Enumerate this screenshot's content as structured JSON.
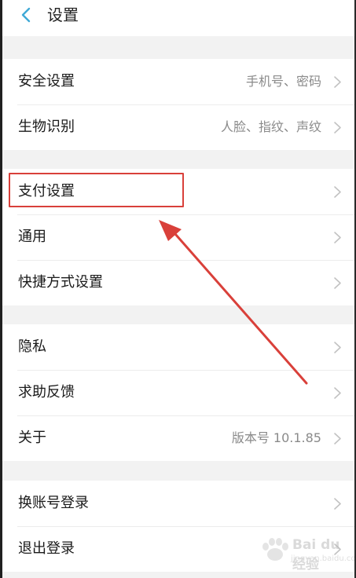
{
  "header": {
    "title": "设置"
  },
  "groups": [
    {
      "items": [
        {
          "label": "安全设置",
          "value": "手机号、密码"
        },
        {
          "label": "生物识别",
          "value": "人脸、指纹、声纹"
        }
      ]
    },
    {
      "items": [
        {
          "label": "支付设置",
          "value": ""
        },
        {
          "label": "通用",
          "value": ""
        },
        {
          "label": "快捷方式设置",
          "value": ""
        }
      ]
    },
    {
      "items": [
        {
          "label": "隐私",
          "value": ""
        },
        {
          "label": "求助反馈",
          "value": ""
        },
        {
          "label": "关于",
          "value": "版本号 10.1.85"
        }
      ]
    },
    {
      "items": [
        {
          "label": "换账号登录",
          "value": ""
        },
        {
          "label": "退出登录",
          "value": ""
        }
      ]
    }
  ],
  "annotation": {
    "color": "#d9403a",
    "highlighted_item": "支付设置"
  },
  "watermark": {
    "brand": "Bai du 经验",
    "url": "jingyan.baidu.com"
  },
  "icons": {
    "back": "chevron-left-icon",
    "row_arrow": "chevron-right-icon"
  },
  "colors": {
    "accent": "#3fa9d6",
    "background": "#f2f2f2"
  }
}
